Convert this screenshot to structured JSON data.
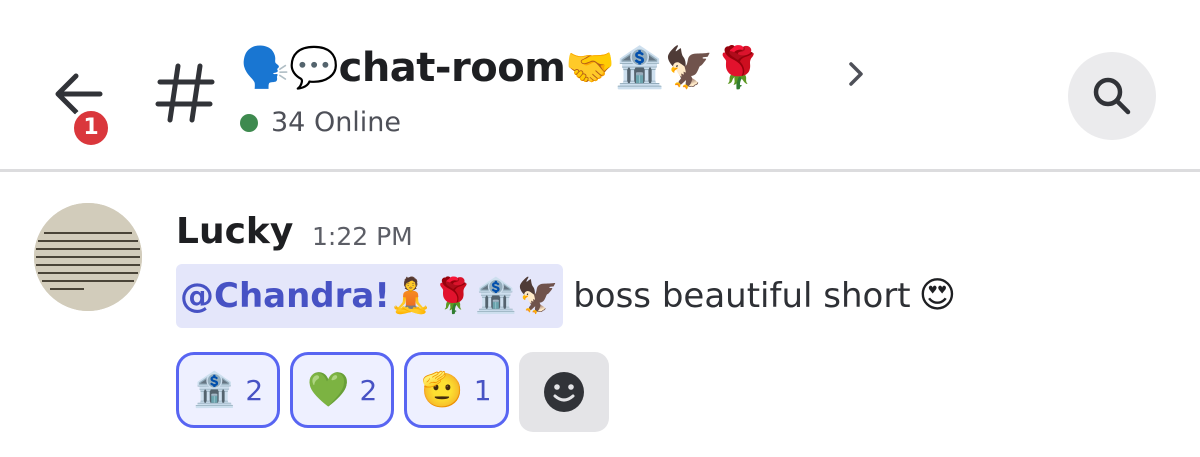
{
  "header": {
    "notification_count": "1",
    "channel_name": "🗣️💬chat-room🤝🏦🦅🌹",
    "online_text": "34 Online"
  },
  "message": {
    "author": "Lucky",
    "timestamp": "1:22 PM",
    "mention": "@Chandra!🧘🌹🏦🦅",
    "text": "boss beautiful short",
    "trailing_emoji": "😍"
  },
  "reactions": [
    {
      "emoji": "🏦",
      "count": "2"
    },
    {
      "emoji": "💚",
      "count": "2"
    },
    {
      "emoji": "🫡",
      "count": "1"
    }
  ],
  "colors": {
    "accent": "#5865f2",
    "badge": "#da373c",
    "online": "#3e8a4f",
    "mention_bg": "#e4e6fa"
  }
}
